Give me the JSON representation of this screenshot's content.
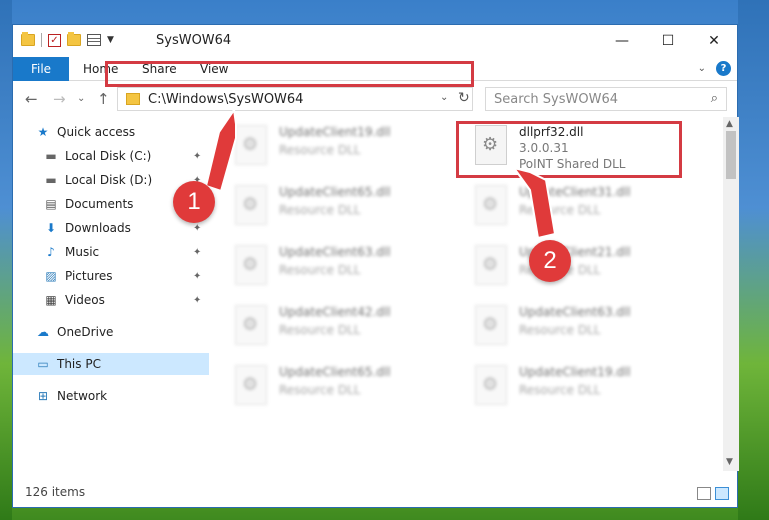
{
  "window": {
    "title": "SysWOW64",
    "minimize_glyph": "—",
    "maximize_glyph": "☐",
    "close_glyph": "✕"
  },
  "ribbon": {
    "tabs": [
      "File",
      "Home",
      "Share",
      "View"
    ],
    "expand_glyph": "⌄",
    "help_glyph": "?"
  },
  "address": {
    "back_glyph": "←",
    "forward_glyph": "→",
    "recent_glyph": "⌄",
    "up_glyph": "↑",
    "path": "C:\\Windows\\SysWOW64",
    "dropdown_glyph": "⌄",
    "refresh_glyph": "↻"
  },
  "search": {
    "placeholder": "Search SysWOW64",
    "icon": "magnifier-icon",
    "glyph": "⌕"
  },
  "sidebar": {
    "items": [
      {
        "label": "Quick access",
        "icon": "star-icon",
        "glyph": "★",
        "pinned": false
      },
      {
        "label": "Local Disk (C:)",
        "icon": "drive-icon",
        "glyph": "▬",
        "pinned": true
      },
      {
        "label": "Local Disk (D:)",
        "icon": "drive-icon",
        "glyph": "▬",
        "pinned": true
      },
      {
        "label": "Documents",
        "icon": "document-icon",
        "glyph": "▤",
        "pinned": true
      },
      {
        "label": "Downloads",
        "icon": "download-icon",
        "glyph": "⬇",
        "pinned": true
      },
      {
        "label": "Music",
        "icon": "music-icon",
        "glyph": "♪",
        "pinned": true
      },
      {
        "label": "Pictures",
        "icon": "picture-icon",
        "glyph": "▨",
        "pinned": true
      },
      {
        "label": "Videos",
        "icon": "video-icon",
        "glyph": "▦",
        "pinned": true
      },
      {
        "label": "OneDrive",
        "icon": "cloud-icon",
        "glyph": "☁",
        "pinned": false
      },
      {
        "label": "This PC",
        "icon": "computer-icon",
        "glyph": "▭",
        "pinned": false,
        "selected": true
      },
      {
        "label": "Network",
        "icon": "network-icon",
        "glyph": "⊞",
        "pinned": false
      }
    ],
    "pin_glyph": "✦"
  },
  "files": {
    "highlighted": {
      "name": "dllprf32.dll",
      "version": "3.0.0.31",
      "description": "PoINT Shared DLL"
    },
    "left_column": [
      {
        "name": "UpdateClient19.dll",
        "type": "Resource DLL"
      },
      {
        "name": "UpdateClient65.dll",
        "type": "Resource DLL"
      },
      {
        "name": "UpdateClient63.dll",
        "type": "Resource DLL"
      },
      {
        "name": "UpdateClient42.dll",
        "type": "Resource DLL"
      },
      {
        "name": "UpdateClient65.dll",
        "type": "Resource DLL"
      }
    ],
    "right_column": [
      {
        "name": "UpdateClient31.dll",
        "type": "Resource DLL"
      },
      {
        "name": "UpdateClient21.dll",
        "type": "Resource DLL"
      },
      {
        "name": "UpdateClient63.dll",
        "type": "Resource DLL"
      },
      {
        "name": "UpdateClient19.dll",
        "type": "Resource DLL"
      }
    ]
  },
  "status": {
    "item_count": "126 items"
  },
  "callouts": {
    "step1": "1",
    "step2": "2"
  },
  "colors": {
    "accent": "#1979ca",
    "highlight": "#d43b43",
    "selection": "#cce8ff"
  }
}
